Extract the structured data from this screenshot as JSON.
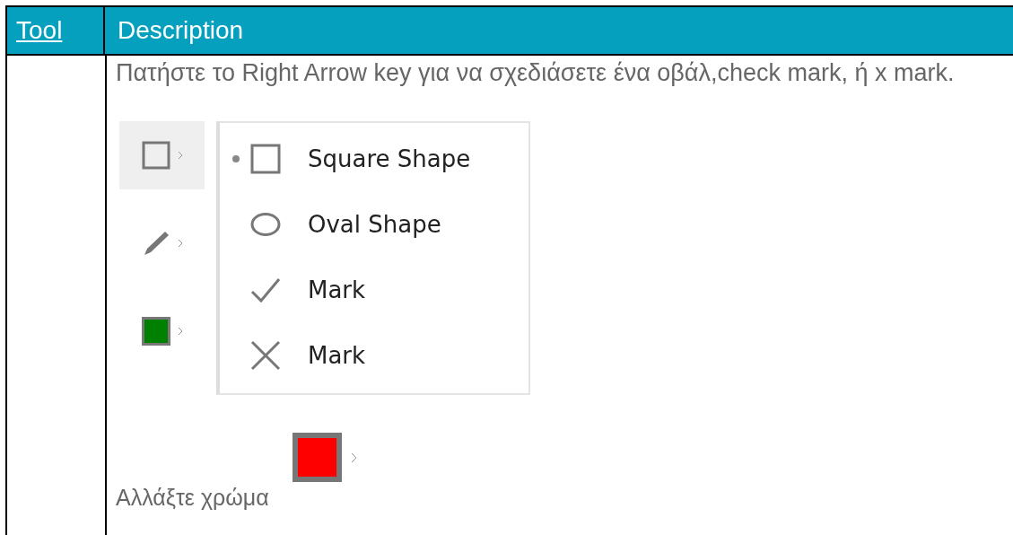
{
  "table": {
    "columns": [
      {
        "label": "Tool",
        "link": true
      },
      {
        "label": "Description",
        "link": false
      }
    ],
    "row": {
      "instruction": "Πατήστε το Right Arrow key για να σχεδιάσετε ένα οβάλ,check mark, ή x mark.",
      "toolbar": [
        {
          "kind": "square",
          "selected": true
        },
        {
          "kind": "pen",
          "selected": false
        },
        {
          "kind": "color",
          "selected": false,
          "color": "#008000"
        }
      ],
      "menu": [
        {
          "kind": "square",
          "label": "Square Shape",
          "selected": true
        },
        {
          "kind": "oval",
          "label": "Oval Shape",
          "selected": false
        },
        {
          "kind": "check",
          "label": "Mark",
          "selected": false
        },
        {
          "kind": "x",
          "label": "Mark",
          "selected": false
        }
      ],
      "caption": "Αλλάξτε χρώμα",
      "color_button": {
        "color": "#ff0000"
      }
    }
  }
}
